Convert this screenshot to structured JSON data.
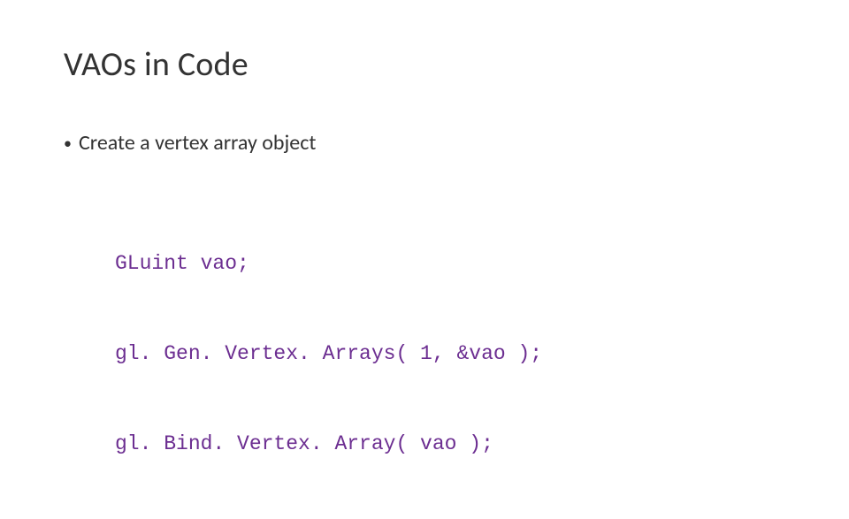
{
  "slide": {
    "title": "VAOs in Code",
    "bullet": "Create a vertex array object",
    "code": {
      "line1": "GLuint vao;",
      "line2": "gl. Gen. Vertex. Arrays( 1, &vao );",
      "line3": "gl. Bind. Vertex. Array( vao );"
    }
  }
}
